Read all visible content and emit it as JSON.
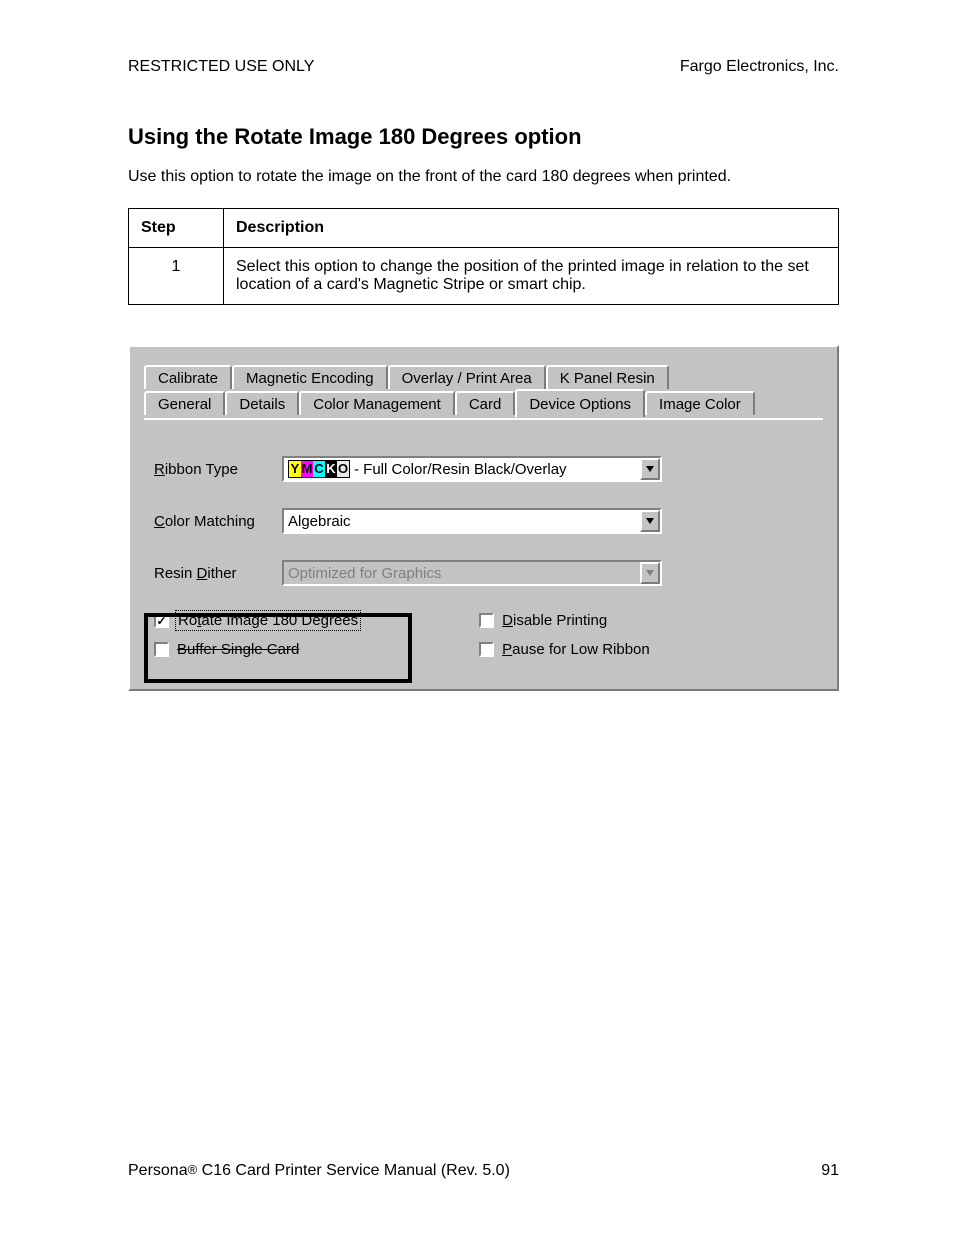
{
  "header": {
    "left": "RESTRICTED USE ONLY",
    "right": "Fargo Electronics, Inc."
  },
  "title": "Using the Rotate Image 180 Degrees option",
  "intro": "Use this option to rotate the image on the front of the card 180 degrees when printed.",
  "table": {
    "col_step": "Step",
    "col_desc": "Description",
    "rows": [
      {
        "step": "1",
        "desc": "Select this option to change the position of the printed image in relation to the set location of a card's Magnetic Stripe or smart chip."
      }
    ]
  },
  "dialog": {
    "tabs_row1": [
      "Calibrate",
      "Magnetic Encoding",
      "Overlay / Print Area",
      "K Panel Resin"
    ],
    "tabs_row2": [
      "General",
      "Details",
      "Color Management",
      "Card",
      "Device Options",
      "Image Color"
    ],
    "active_tab": "Device Options",
    "labels": {
      "ribbon_type_pre": "R",
      "ribbon_type_post": "ibbon Type",
      "color_matching_pre": "C",
      "color_matching_post": "olor Matching",
      "resin_dither_pre": "Resin ",
      "resin_dither_u": "D",
      "resin_dither_post": "ither"
    },
    "ribbon_type": {
      "icon": "YMCKO",
      "value": " - Full Color/Resin Black/Overlay"
    },
    "color_matching": {
      "value": "Algebraic"
    },
    "resin_dither": {
      "value": "Optimized for Graphics",
      "disabled": true
    },
    "checkboxes": {
      "rotate": {
        "pre": "Ro",
        "u": "t",
        "post": "ate Image 180 Degrees",
        "checked": true
      },
      "buffer": {
        "label": "Buffer Single Card",
        "checked": false
      },
      "disable_printing": {
        "u": "D",
        "post": "isable Printing",
        "checked": false
      },
      "pause_low_ribbon": {
        "u": "P",
        "post": "ause for Low Ribbon",
        "checked": false
      }
    }
  },
  "footer": {
    "left_pre": "Persona",
    "left_reg": "®",
    "left_post": " C16 Card Printer Service Manual (Rev. 5.0)",
    "page": "91"
  }
}
